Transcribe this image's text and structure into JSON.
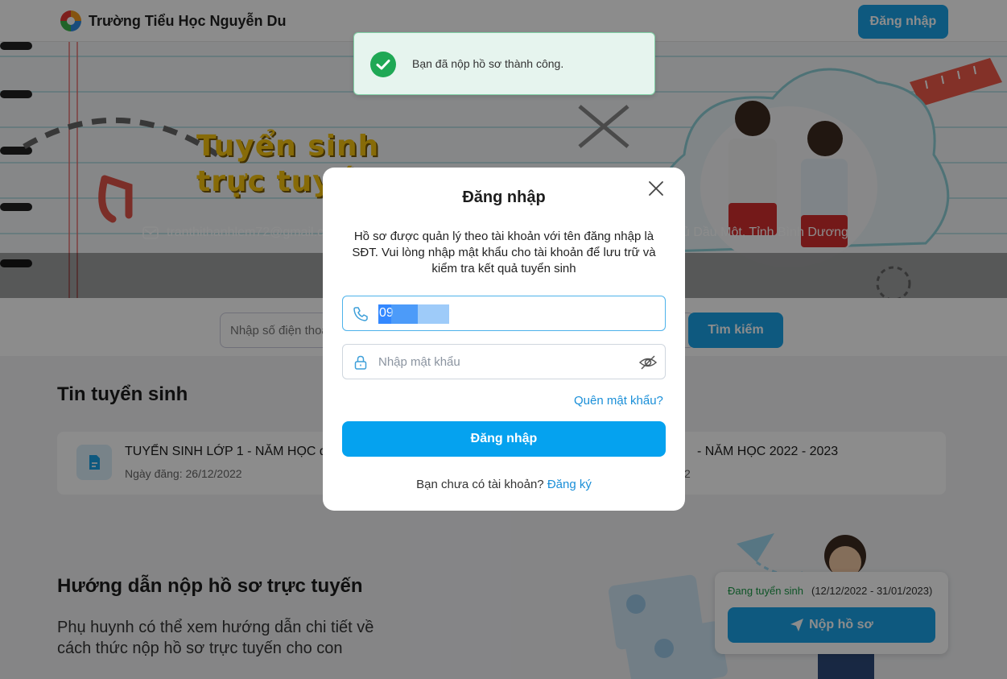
{
  "header": {
    "school_name": "Trường Tiểu Học Nguyễn Du",
    "login_label": "Đăng nhập"
  },
  "banner": {
    "title_line1": "Tuyển sinh",
    "title_line2": "trực tuyến",
    "email": "tranthithanhlem72@gmail.c",
    "address": "ủ Dầu Một, Tỉnh Bình Dương"
  },
  "search": {
    "placeholder": "Nhập số điện thoại",
    "button_label": "Tìm kiếm"
  },
  "news": {
    "title": "Tin tuyển sinh",
    "items": [
      {
        "headline": "TUYỂN SINH LỚP 1 - NĂM HỌC đợ",
        "date": "Ngày đăng: 26/12/2022"
      },
      {
        "headline": "- NĂM HỌC 2022 - 2023",
        "date": "2"
      }
    ]
  },
  "guide": {
    "title": "Hướng dẫn nộp hồ sơ trực tuyến",
    "description": "Phụ huynh có thể xem hướng dẫn chi tiết về cách thức nộp hồ sơ trực tuyến cho con"
  },
  "admission": {
    "status": "Đang tuyển sinh",
    "range": "(12/12/2022 - 31/01/2023)",
    "submit_label": "Nộp hồ sơ"
  },
  "toast": {
    "message": "Bạn đã nộp hồ sơ thành công."
  },
  "modal": {
    "title": "Đăng nhập",
    "description": "Hồ sơ được quản lý theo tài khoản với tên đăng nhập là SĐT. Vui lòng nhập mật khẩu cho tài khoản để lưu trữ và kiểm tra kết quả tuyển sinh",
    "phone_value": "09",
    "password_placeholder": "Nhập mật khẩu",
    "forgot_label": "Quên mật khẩu?",
    "login_label": "Đăng nhập",
    "no_account_text": "Bạn chưa có tài khoản?",
    "signup_label": "Đăng ký"
  },
  "colors": {
    "primary": "#1aa3e8",
    "success": "#1b9a48",
    "banner_title": "#f6c40f"
  }
}
